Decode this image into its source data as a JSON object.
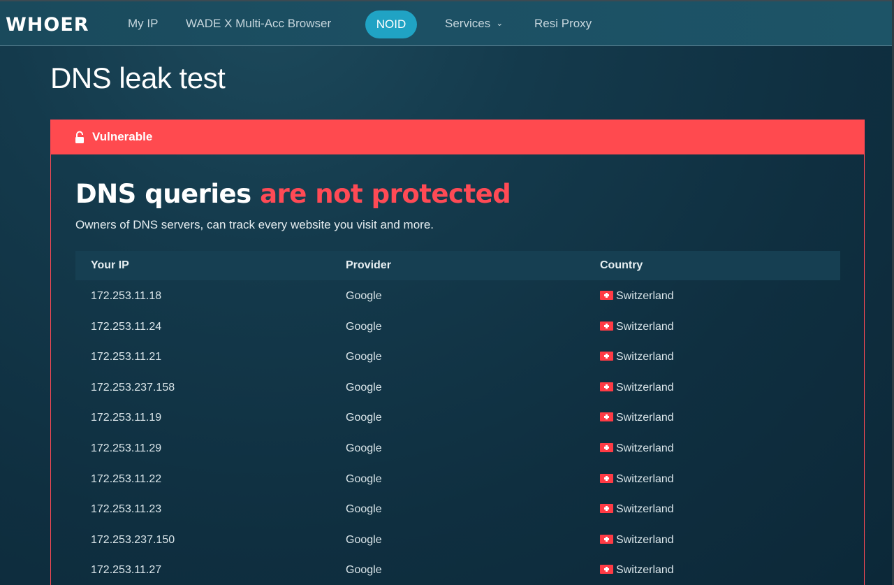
{
  "nav": {
    "logo": "WHOER",
    "items": [
      "My IP",
      "WADE X Multi-Acc Browser",
      "NOID",
      "Services",
      "Resi Proxy"
    ]
  },
  "page_title": "DNS leak test",
  "status": {
    "label": "Vulnerable",
    "color": "#ff4a4f"
  },
  "headline": {
    "part1": "DNS queries",
    "part2": "are not protected"
  },
  "subtext": "Owners of DNS servers, can track every website you visit and more.",
  "table": {
    "headers": [
      "Your IP",
      "Provider",
      "Country"
    ],
    "rows": [
      {
        "ip": "172.253.11.18",
        "provider": "Google",
        "country": "Switzerland"
      },
      {
        "ip": "172.253.11.24",
        "provider": "Google",
        "country": "Switzerland"
      },
      {
        "ip": "172.253.11.21",
        "provider": "Google",
        "country": "Switzerland"
      },
      {
        "ip": "172.253.237.158",
        "provider": "Google",
        "country": "Switzerland"
      },
      {
        "ip": "172.253.11.19",
        "provider": "Google",
        "country": "Switzerland"
      },
      {
        "ip": "172.253.11.29",
        "provider": "Google",
        "country": "Switzerland"
      },
      {
        "ip": "172.253.11.22",
        "provider": "Google",
        "country": "Switzerland"
      },
      {
        "ip": "172.253.11.23",
        "provider": "Google",
        "country": "Switzerland"
      },
      {
        "ip": "172.253.237.150",
        "provider": "Google",
        "country": "Switzerland"
      },
      {
        "ip": "172.253.11.27",
        "provider": "Google",
        "country": "Switzerland"
      }
    ]
  }
}
